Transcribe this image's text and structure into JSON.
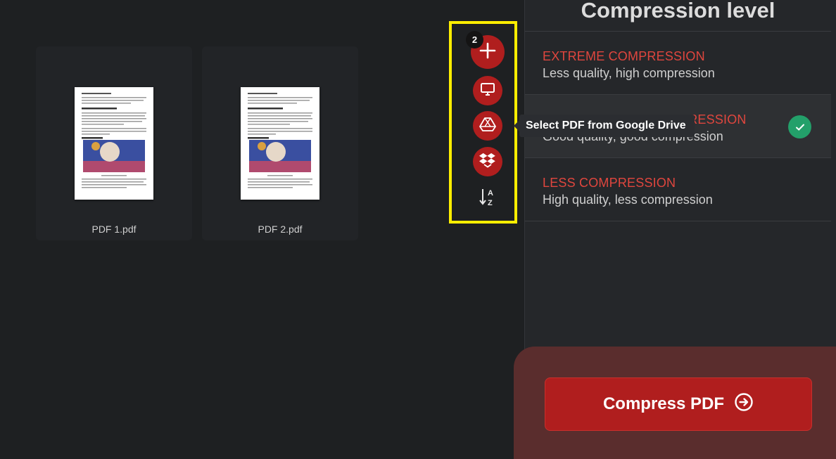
{
  "files": [
    {
      "name": "PDF 1.pdf"
    },
    {
      "name": "PDF 2.pdf"
    }
  ],
  "toolbar": {
    "file_count_badge": "2",
    "add_icon": "plus-icon",
    "computer_icon": "monitor-icon",
    "gdrive_icon": "google-drive-icon",
    "dropbox_icon": "dropbox-icon",
    "sort_icon": "sort-az-icon",
    "tooltip": "Select PDF from Google Drive",
    "highlight_color": "#ffee00"
  },
  "sidebar": {
    "title": "Compression level",
    "options": [
      {
        "title": "EXTREME COMPRESSION",
        "subtitle": "Less quality, high compression",
        "selected": false
      },
      {
        "title": "RECOMMENDED COMPRESSION",
        "subtitle": "Good quality, good compression",
        "selected": true
      },
      {
        "title": "LESS COMPRESSION",
        "subtitle": "High quality, less compression",
        "selected": false
      }
    ]
  },
  "cta": {
    "label": "Compress PDF",
    "icon": "arrow-right-circle-icon"
  },
  "colors": {
    "accent": "#b01e1e",
    "option_title": "#e0463e",
    "check": "#23a06a"
  }
}
